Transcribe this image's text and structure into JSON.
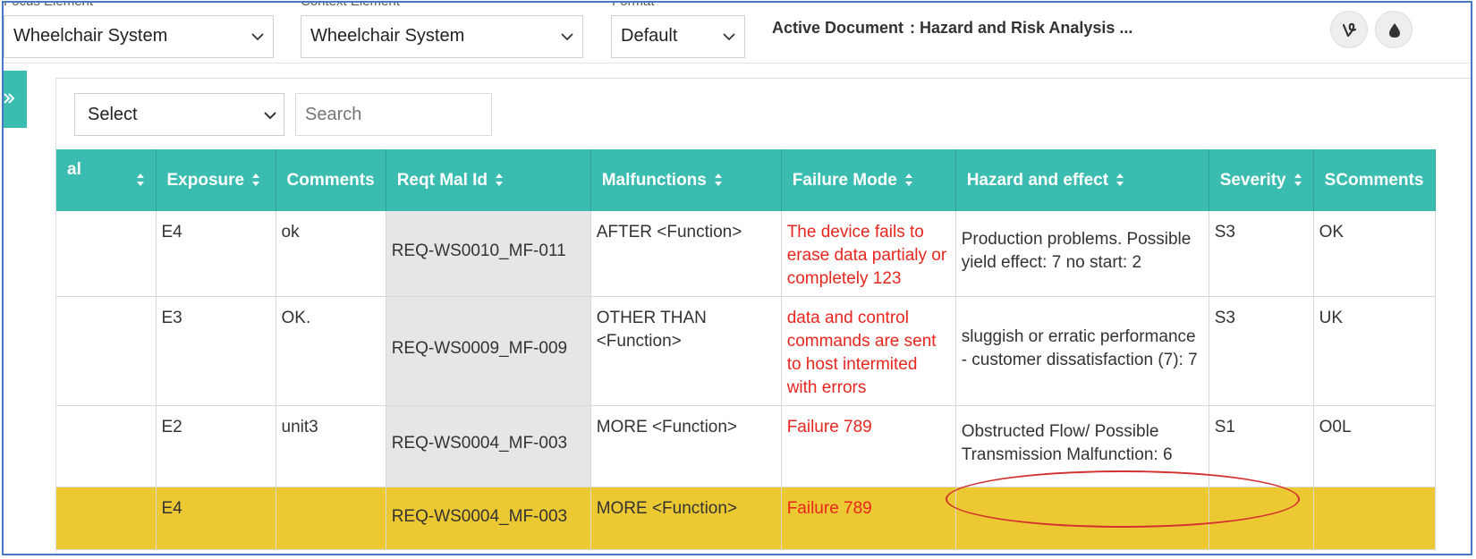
{
  "topbar": {
    "focus_label": "Focus Element",
    "context_label": "Context Element",
    "format_label": "Format",
    "focus_value": "Wheelchair System",
    "context_value": "Wheelchair System",
    "format_value": "Default",
    "active_doc_label": "Active Document",
    "active_doc_value": ": Hazard and Risk Analysis ..."
  },
  "toolbar": {
    "select_value": "Select",
    "search_placeholder": "Search"
  },
  "table": {
    "headers": [
      "al",
      "Exposure",
      "Comments",
      "Reqt Mal Id",
      "Malfunctions",
      "Failure Mode",
      "Hazard and effect",
      "Severity",
      "SComments"
    ],
    "rows": [
      {
        "exposure": "E4",
        "comments": "ok",
        "reqt": "REQ-WS0010_MF-011",
        "malfunction": "AFTER <Function>",
        "failure": "The device fails to erase data partialy or completely 123",
        "hazard": "Production problems. Possible yield effect: 7 no start: 2",
        "severity": "S3",
        "scomments": "OK"
      },
      {
        "exposure": "E3",
        "comments": "OK.",
        "reqt": "REQ-WS0009_MF-009",
        "malfunction": "OTHER THAN <Function>",
        "failure": "data and control commands are sent to host intermited with errors",
        "hazard": "sluggish or erratic performance - customer dissatisfaction (7): 7",
        "severity": "S3",
        "scomments": "UK"
      },
      {
        "exposure": "E2",
        "comments": "unit3",
        "reqt": "REQ-WS0004_MF-003",
        "malfunction": "MORE <Function>",
        "failure": "Failure 789",
        "hazard": "Obstructed Flow/ Possible Transmission Malfunction: 6",
        "severity": "S1",
        "scomments": "O0L"
      },
      {
        "exposure": "E4",
        "comments": "",
        "reqt": "REQ-WS0004_MF-003",
        "malfunction": "MORE <Function>",
        "failure": "Failure 789",
        "hazard": "",
        "severity": "",
        "scomments": ""
      }
    ]
  },
  "colors": {
    "header_teal": "#3bbcb0",
    "highlight_row": "#ecc832",
    "failure_text": "#e8261e",
    "annotation_ellipse": "#d43030"
  },
  "icons": {
    "dropdown": "chevron-down-icon",
    "sort": "sort-updown-icon",
    "vine": "vine-icon",
    "drop": "drop-icon",
    "expand": "double-chevron-right-icon"
  }
}
